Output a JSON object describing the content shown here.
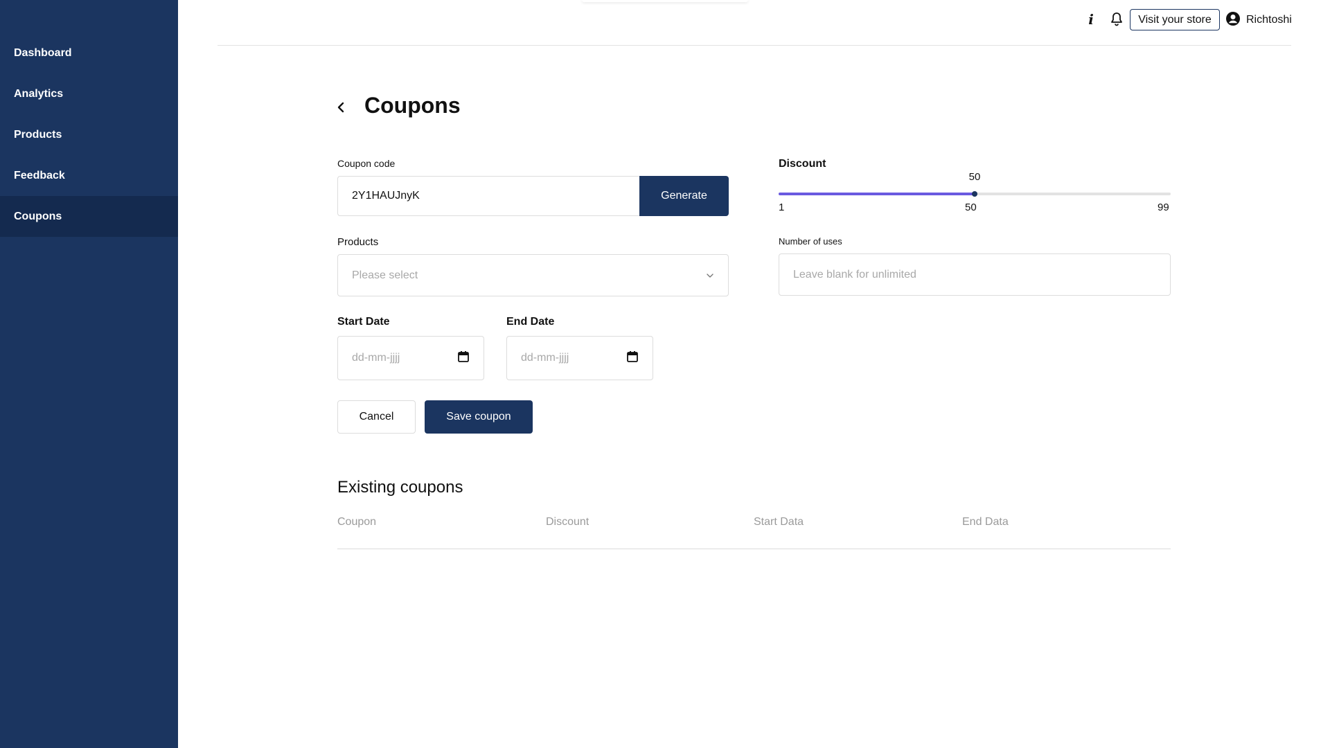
{
  "sidebar": {
    "items": [
      {
        "label": "Dashboard"
      },
      {
        "label": "Analytics"
      },
      {
        "label": "Products"
      },
      {
        "label": "Feedback"
      },
      {
        "label": "Coupons"
      }
    ]
  },
  "topbar": {
    "info_icon": "info-icon",
    "bell_icon": "bell-icon",
    "visit_store_label": "Visit your store",
    "user_icon": "user-circle-icon",
    "user_name": "Richtoshi"
  },
  "page": {
    "title": "Coupons",
    "back_icon": "chevron-left-icon"
  },
  "form": {
    "coupon_code_label": "Coupon code",
    "coupon_code_value": "2Y1HAUJnyK",
    "generate_label": "Generate",
    "products_label": "Products",
    "products_placeholder": "Please select",
    "start_date_label": "Start Date",
    "start_date_placeholder": "dd-mm-jjjj",
    "end_date_label": "End Date",
    "end_date_placeholder": "dd-mm-jjjj",
    "calendar_icon": "calendar-icon",
    "cancel_label": "Cancel",
    "save_label": "Save coupon"
  },
  "discount": {
    "label": "Discount",
    "value": 50,
    "value_text": "50",
    "min": 1,
    "max": 99,
    "min_text": "1",
    "mid_text": "50",
    "max_text": "99",
    "fill_color": "#6a5ae0"
  },
  "uses": {
    "label": "Number of uses",
    "placeholder": "Leave blank for unlimited"
  },
  "existing": {
    "title": "Existing coupons",
    "columns": [
      "Coupon",
      "Discount",
      "Start Data",
      "End Data"
    ]
  },
  "colors": {
    "sidebar_bg": "#1b3560",
    "sidebar_active_bg": "#142a4f",
    "primary": "#1b3560",
    "slider_fill": "#6a5ae0"
  }
}
